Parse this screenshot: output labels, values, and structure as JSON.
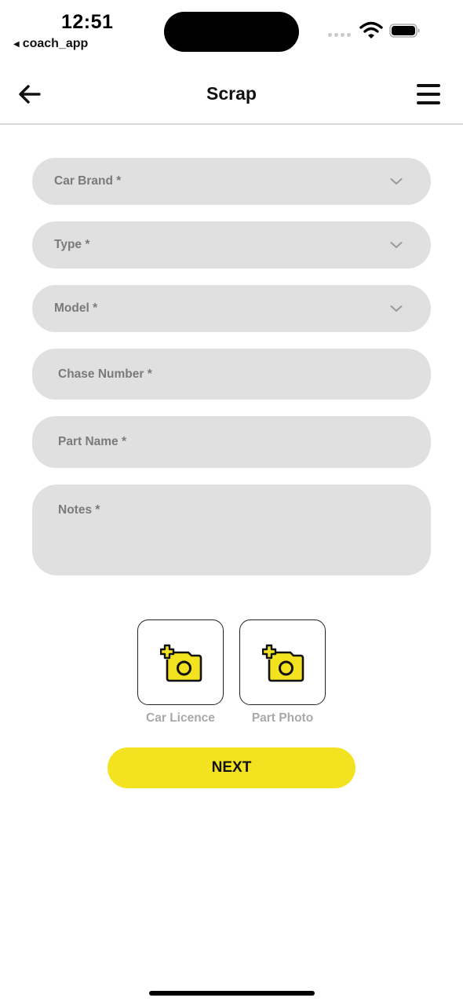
{
  "status_bar": {
    "time": "12:51",
    "back_app": "coach_app",
    "back_glyph": "◀",
    "icons": [
      "signal-dots-icon",
      "wifi-icon",
      "battery-icon"
    ]
  },
  "header": {
    "title": "Scrap",
    "back_icon": "arrow-left-icon",
    "menu_icon": "hamburger-menu-icon"
  },
  "form": {
    "car_brand": {
      "placeholder": "Car Brand *",
      "type": "select",
      "icon": "chevron-down-icon"
    },
    "type": {
      "placeholder": "Type *",
      "type": "select",
      "icon": "chevron-down-icon"
    },
    "model": {
      "placeholder": "Model *",
      "type": "select",
      "icon": "chevron-down-icon"
    },
    "chase_number": {
      "placeholder": "Chase Number *",
      "value": ""
    },
    "part_name": {
      "placeholder": "Part Name *",
      "value": ""
    },
    "notes": {
      "placeholder": "Notes *",
      "value": ""
    }
  },
  "uploads": [
    {
      "label": "Car Licence",
      "icon": "add-photo-icon"
    },
    {
      "label": "Part Photo",
      "icon": "add-photo-icon"
    }
  ],
  "actions": {
    "next_label": "NEXT"
  },
  "colors": {
    "accent_yellow": "#f3e220",
    "field_bg": "#e0e0e0",
    "placeholder": "#7a7a7a",
    "upload_label": "#a9a9a9"
  }
}
